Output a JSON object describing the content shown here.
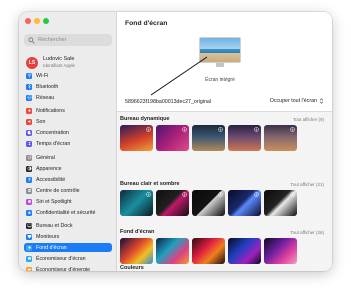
{
  "window": {
    "title": "Fond d'écran"
  },
  "search": {
    "placeholder": "Rechercher"
  },
  "account": {
    "initials": "LS",
    "name": "Ludovic Sale",
    "subtitle": "Identifiant Apple",
    "avatar_color": "#e8403d"
  },
  "sidebar": {
    "accent": "#1b7cf5",
    "items": [
      {
        "label": "Wi-Fi",
        "icon": "wifi-icon",
        "color": "#1b7cf5"
      },
      {
        "label": "Bluetooth",
        "icon": "bluetooth-icon",
        "color": "#1b7cf5"
      },
      {
        "label": "Réseau",
        "icon": "globe-icon",
        "color": "#1b7cf5"
      },
      {
        "label": "Notifications",
        "icon": "bell-icon",
        "color": "#f0453a"
      },
      {
        "label": "Son",
        "icon": "speaker-icon",
        "color": "#f0453a"
      },
      {
        "label": "Concentration",
        "icon": "moon-icon",
        "color": "#5e5ce6"
      },
      {
        "label": "Temps d'écran",
        "icon": "hourglass-icon",
        "color": "#5e5ce6"
      },
      {
        "label": "Général",
        "icon": "gear-icon",
        "color": "#8e8e93"
      },
      {
        "label": "Apparence",
        "icon": "appearance-icon",
        "color": "#222222"
      },
      {
        "label": "Accessibilité",
        "icon": "accessibility-icon",
        "color": "#1b7cf5"
      },
      {
        "label": "Centre de contrôle",
        "icon": "control-center-icon",
        "color": "#8e8e93"
      },
      {
        "label": "Siri et Spotlight",
        "icon": "siri-icon",
        "color": "#b44fe0"
      },
      {
        "label": "Confidentialité et sécurité",
        "icon": "hand-icon",
        "color": "#1b7cf5"
      },
      {
        "label": "Bureau et Dock",
        "icon": "dock-icon",
        "color": "#222222"
      },
      {
        "label": "Moniteurs",
        "icon": "display-icon",
        "color": "#1b7cf5"
      },
      {
        "label": "Fond d'écran",
        "icon": "wallpaper-icon",
        "color": "#2fa8e8"
      },
      {
        "label": "Économiseur d'écran",
        "icon": "screensaver-icon",
        "color": "#2fa8e8"
      },
      {
        "label": "Économiseur d'énergie",
        "icon": "battery-icon",
        "color": "#f0a030"
      }
    ]
  },
  "main": {
    "display_label": "Écran intégré",
    "filename": "5896623f198ba00013dec27_original",
    "fill_mode": "Occuper tout l'écran",
    "sections": [
      {
        "title": "Bureau dynamique",
        "link": "Tout afficher (9)"
      },
      {
        "title": "Bureau clair et sombre",
        "link": "Tout afficher (21)"
      },
      {
        "title": "Fond d'écran",
        "link": "Tout afficher (26)"
      },
      {
        "title": "Couleurs",
        "link": ""
      }
    ]
  }
}
